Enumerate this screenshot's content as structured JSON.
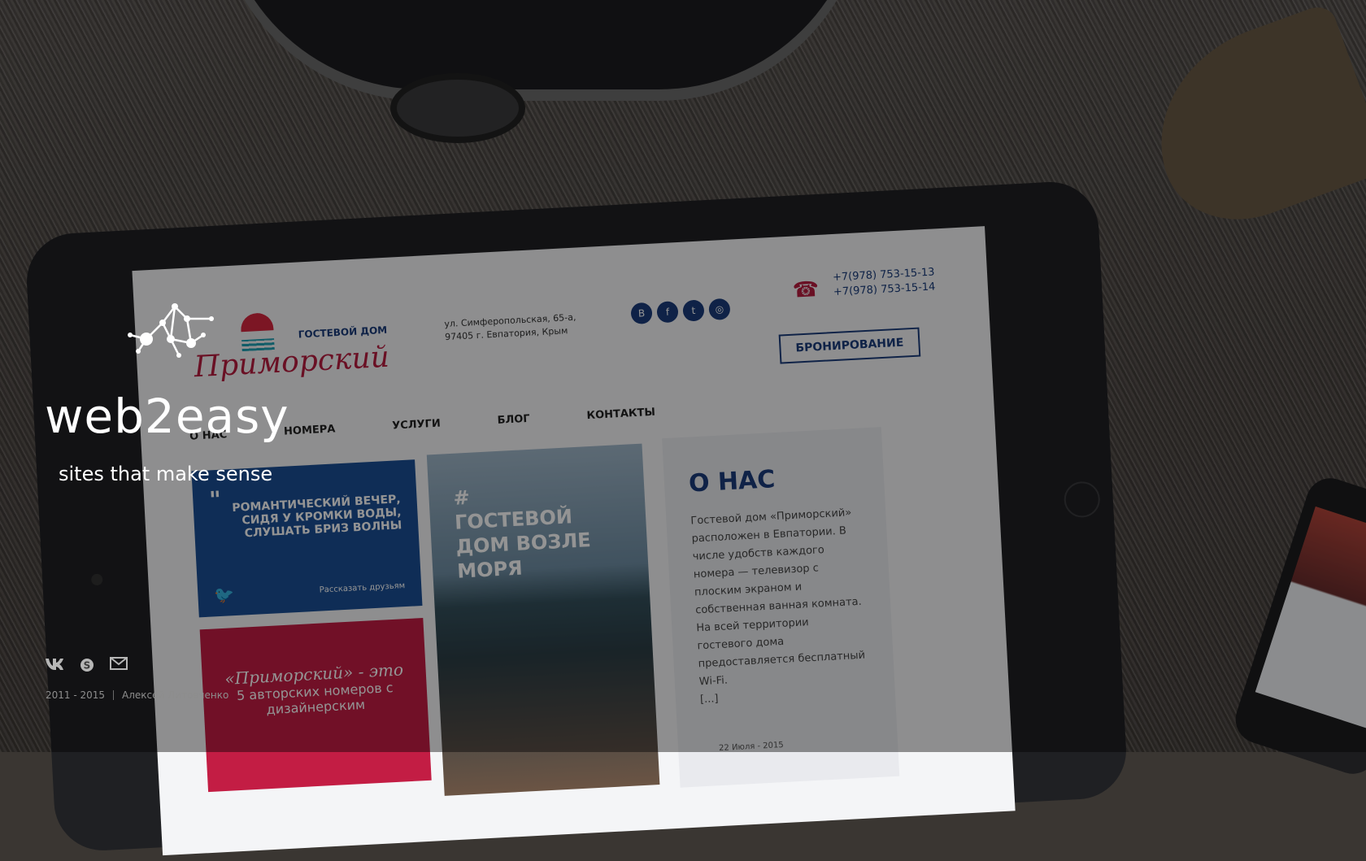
{
  "brand": {
    "name": "web2easy",
    "tagline": "sites that make sense"
  },
  "footer": {
    "years": "2011 - 2015",
    "author": "Алексей Литовченко",
    "icons": [
      "vk-icon",
      "skype-icon",
      "mail-icon"
    ]
  },
  "mockup_site": {
    "logo_small": "ГОСТЕВОЙ ДОМ",
    "logo_big": "Приморский",
    "address_line1": "ул. Симферопольская, 65-а,",
    "address_line2": "97405 г. Евпатория, Крым",
    "phone1": "+7(978) 753-15-13",
    "phone2": "+7(978) 753-15-14",
    "booking": "БРОНИРОВАНИЕ",
    "nav": [
      "О НАС",
      "НОМЕРА",
      "УСЛУГИ",
      "БЛОГ",
      "КОНТАКТЫ"
    ],
    "quote_text": "РОМАНТИЧЕСКИЙ ВЕЧЕР, СИДЯ У КРОМКИ ВОДЫ, СЛУШАТЬ БРИЗ ВОЛНЫ",
    "share": "Рассказать друзьям",
    "red_script": "«Приморский» - это",
    "red_text": "5 авторских номеров с дизайнерским",
    "photo_hash": "#",
    "photo_text": "ГОСТЕВОЙ ДОМ ВОЗЛЕ МОРЯ",
    "about_title": "О НАС",
    "about_text": "Гостевой дом «Приморский» расположен в Евпатории. В числе удобств каждого номера — телевизор с плоским экраном и собственная ванная комната. На всей территории гостевого дома предоставляется бесплатный Wi-Fi.",
    "about_more": "[...]",
    "about_date": "22 Июля - 2015"
  },
  "colors": {
    "brand_text": "#ffffff",
    "footer_text": "#8d8d8d",
    "site_blue": "#1b4f94",
    "site_red": "#c31d44"
  }
}
